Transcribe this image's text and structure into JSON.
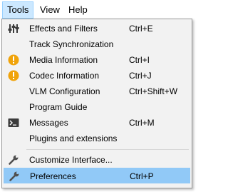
{
  "menubar": {
    "items": [
      {
        "label": "Tools"
      },
      {
        "label": "View"
      },
      {
        "label": "Help"
      }
    ]
  },
  "menu": {
    "items": [
      {
        "label": "Effects and Filters",
        "shortcut": "Ctrl+E",
        "icon": "equalizer-icon"
      },
      {
        "label": "Track Synchronization",
        "shortcut": ""
      },
      {
        "label": "Media Information",
        "shortcut": "Ctrl+I",
        "icon": "info-icon"
      },
      {
        "label": "Codec Information",
        "shortcut": "Ctrl+J",
        "icon": "info-icon"
      },
      {
        "label": "VLM Configuration",
        "shortcut": "Ctrl+Shift+W"
      },
      {
        "label": "Program Guide",
        "shortcut": ""
      },
      {
        "label": "Messages",
        "shortcut": "Ctrl+M",
        "icon": "terminal-icon"
      },
      {
        "label": "Plugins and extensions",
        "shortcut": ""
      },
      {
        "label": "Customize Interface...",
        "shortcut": "",
        "icon": "wrench-icon"
      },
      {
        "label": "Preferences",
        "shortcut": "Ctrl+P",
        "icon": "wrench-icon"
      }
    ]
  },
  "colors": {
    "highlight": "#91c9f7",
    "menubar_active": "#cce8ff",
    "info_icon": "#f0a30a",
    "menu_background": "#f2f2f2"
  }
}
